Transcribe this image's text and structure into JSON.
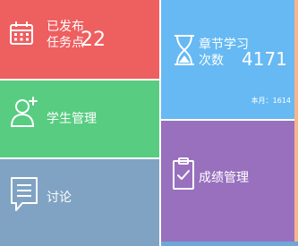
{
  "tiles": {
    "tasks": {
      "label_line1": "已发布",
      "label_line2": "任务点",
      "count": "22",
      "icon": "calendar-icon",
      "color": "#ee5f60"
    },
    "students": {
      "label": "学生管理",
      "icon": "user-add-icon",
      "color": "#58cc80"
    },
    "forum": {
      "label": "讨论",
      "icon": "chat-bubble-icon",
      "color": "#80a3c3"
    },
    "study": {
      "label_line1": "章节学习",
      "label_line2": "次数",
      "count": "4171",
      "month_label": "本月：1614",
      "icon": "hourglass-icon",
      "color": "#66b9f3"
    },
    "grades": {
      "label": "成绩管理",
      "icon": "clipboard-check-icon",
      "color": "#9870bd"
    }
  }
}
